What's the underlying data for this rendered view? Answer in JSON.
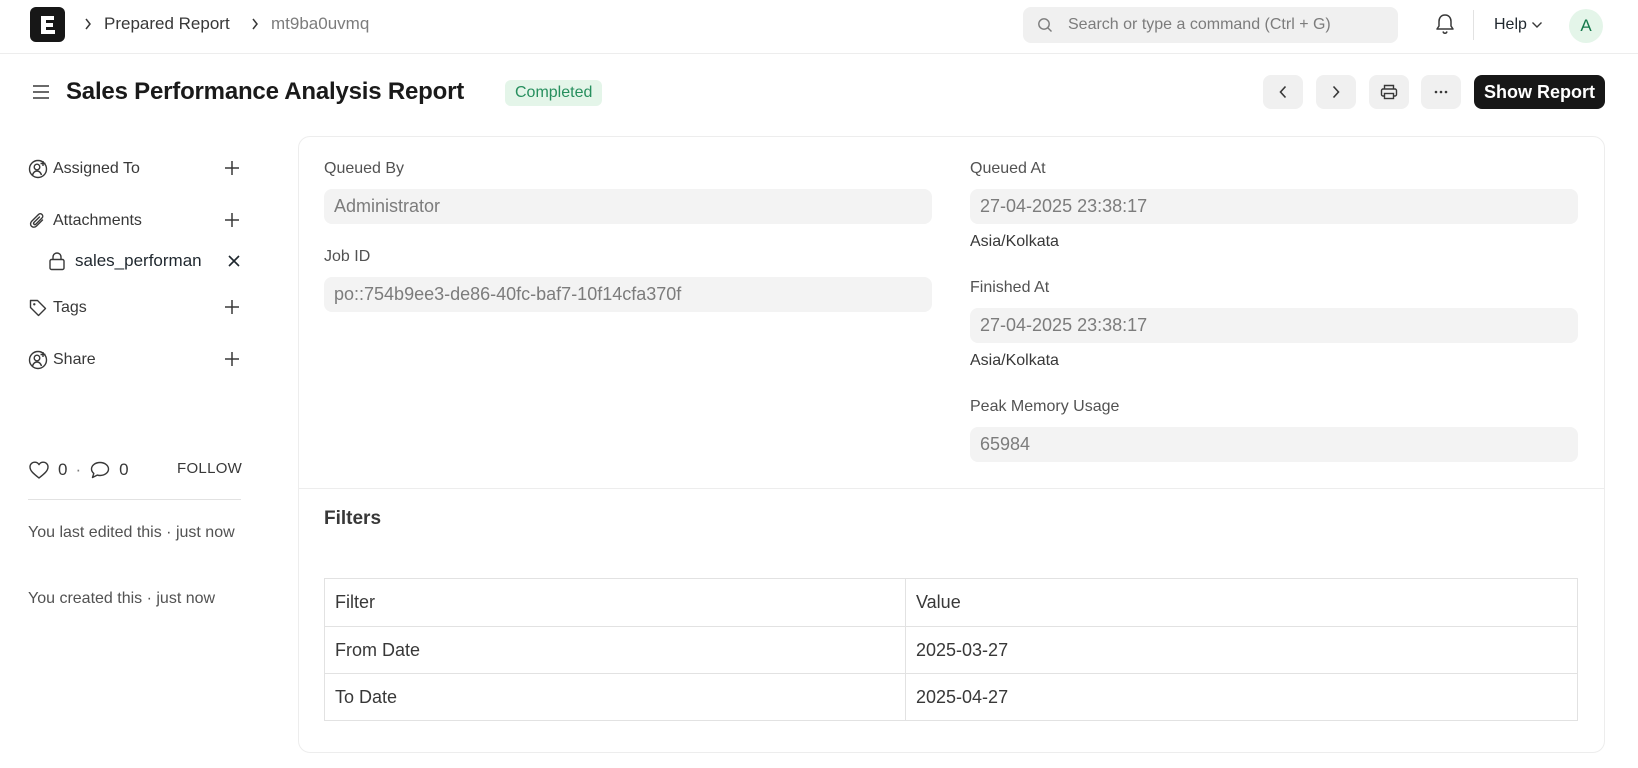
{
  "navbar": {
    "logo_letter": "E",
    "breadcrumbs": [
      "Prepared Report",
      "mt9ba0uvmq"
    ],
    "search_placeholder": "Search or type a command (Ctrl + G)",
    "help_label": "Help",
    "avatar_initial": "A"
  },
  "header": {
    "title": "Sales Performance Analysis Report",
    "status": "Completed",
    "primary_action": "Show Report"
  },
  "sidebar": {
    "assigned_to": "Assigned To",
    "attachments": "Attachments",
    "attachment_file": "sales_performan",
    "tags": "Tags",
    "share": "Share",
    "likes": "0",
    "comments": "0",
    "follow": "FOLLOW",
    "activity_edited": "You last edited this · just now",
    "activity_created": "You created this · just now"
  },
  "form": {
    "queued_by_label": "Queued By",
    "queued_by_value": "Administrator",
    "job_id_label": "Job ID",
    "job_id_value": "po::754b9ee3-de86-40fc-baf7-10f14cfa370f",
    "queued_at_label": "Queued At",
    "queued_at_value": "27-04-2025 23:38:17",
    "queued_at_tz": "Asia/Kolkata",
    "finished_at_label": "Finished At",
    "finished_at_value": "27-04-2025 23:38:17",
    "finished_at_tz": "Asia/Kolkata",
    "peak_memory_label": "Peak Memory Usage",
    "peak_memory_value": "65984"
  },
  "filters": {
    "section_title": "Filters",
    "columns": [
      "Filter",
      "Value"
    ],
    "rows": [
      [
        "From Date",
        "2025-03-27"
      ],
      [
        "To Date",
        "2025-04-27"
      ]
    ]
  },
  "colors": {
    "primary_button": "#171717",
    "status_badge_bg": "#e4f5e9",
    "status_badge_text": "#278f5e"
  }
}
